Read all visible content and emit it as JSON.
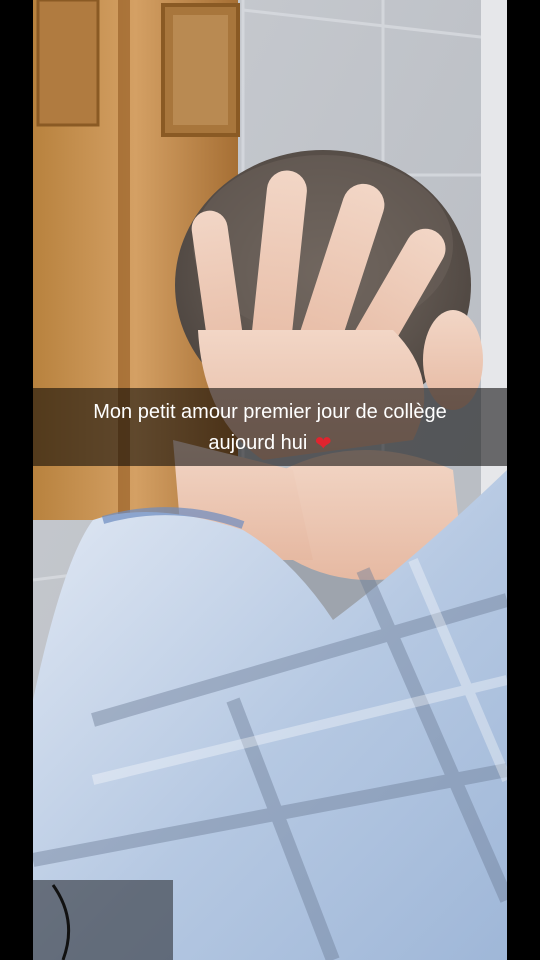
{
  "caption": {
    "text": "Mon petit amour premier jour de collège\naujourd hui",
    "emoji": "❤"
  },
  "colors": {
    "letterbox": "#000000",
    "caption_bar": "rgba(0,0,0,0.55)",
    "caption_text": "#ffffff",
    "heart": "#e0242e"
  },
  "icons": {
    "heart": "heart-emoji-icon"
  }
}
